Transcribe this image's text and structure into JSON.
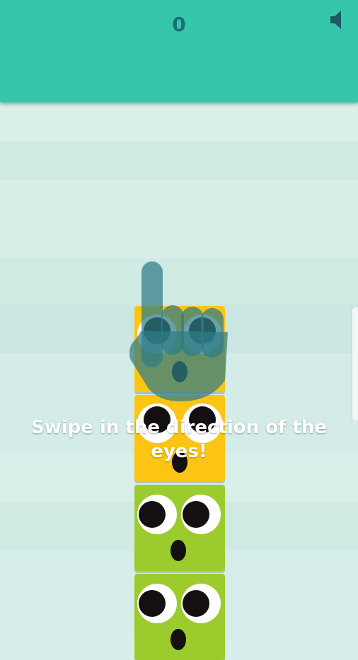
{
  "header": {
    "score": "0",
    "sound_icon": "speaker-icon"
  },
  "tutorial": {
    "instruction": "Swipe in the direction of the eyes!",
    "hand_icon": "pointing-hand-icon"
  },
  "blocks": [
    {
      "color": "yellow",
      "fill": "#fdc513",
      "eyes_direction": "up"
    },
    {
      "color": "yellow",
      "fill": "#fdc513",
      "eyes_direction": "up"
    },
    {
      "color": "green",
      "fill": "#9ccb2e",
      "eyes_direction": "left"
    },
    {
      "color": "green",
      "fill": "#9ccb2e",
      "eyes_direction": "left"
    }
  ],
  "colors": {
    "header": "#36c6ab",
    "score_text": "#1d6e79",
    "background": "#d7efea",
    "hand": "#2e7b86"
  }
}
